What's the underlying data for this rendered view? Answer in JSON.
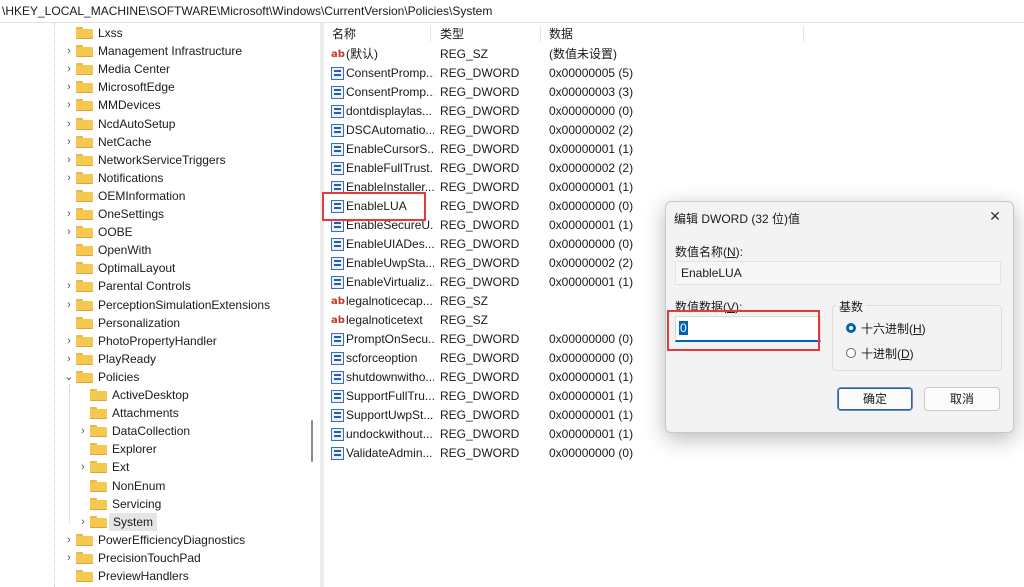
{
  "address_bar": "\\HKEY_LOCAL_MACHINE\\SOFTWARE\\Microsoft\\Windows\\CurrentVersion\\Policies\\System",
  "tree": {
    "items": [
      {
        "label": "Lxss",
        "level": 0,
        "chevron": ""
      },
      {
        "label": "Management Infrastructure",
        "level": 0,
        "chevron": ">"
      },
      {
        "label": "Media Center",
        "level": 0,
        "chevron": ">"
      },
      {
        "label": "MicrosoftEdge",
        "level": 0,
        "chevron": ">"
      },
      {
        "label": "MMDevices",
        "level": 0,
        "chevron": ">"
      },
      {
        "label": "NcdAutoSetup",
        "level": 0,
        "chevron": ">"
      },
      {
        "label": "NetCache",
        "level": 0,
        "chevron": ">"
      },
      {
        "label": "NetworkServiceTriggers",
        "level": 0,
        "chevron": ">"
      },
      {
        "label": "Notifications",
        "level": 0,
        "chevron": ">"
      },
      {
        "label": "OEMInformation",
        "level": 0,
        "chevron": ""
      },
      {
        "label": "OneSettings",
        "level": 0,
        "chevron": ">"
      },
      {
        "label": "OOBE",
        "level": 0,
        "chevron": ">"
      },
      {
        "label": "OpenWith",
        "level": 0,
        "chevron": ""
      },
      {
        "label": "OptimalLayout",
        "level": 0,
        "chevron": ""
      },
      {
        "label": "Parental Controls",
        "level": 0,
        "chevron": ">"
      },
      {
        "label": "PerceptionSimulationExtensions",
        "level": 0,
        "chevron": ">"
      },
      {
        "label": "Personalization",
        "level": 0,
        "chevron": ""
      },
      {
        "label": "PhotoPropertyHandler",
        "level": 0,
        "chevron": ">"
      },
      {
        "label": "PlayReady",
        "level": 0,
        "chevron": ">"
      },
      {
        "label": "Policies",
        "level": 0,
        "chevron": "v"
      },
      {
        "label": "ActiveDesktop",
        "level": 1,
        "chevron": ""
      },
      {
        "label": "Attachments",
        "level": 1,
        "chevron": ""
      },
      {
        "label": "DataCollection",
        "level": 1,
        "chevron": ">"
      },
      {
        "label": "Explorer",
        "level": 1,
        "chevron": ""
      },
      {
        "label": "Ext",
        "level": 1,
        "chevron": ">"
      },
      {
        "label": "NonEnum",
        "level": 1,
        "chevron": ""
      },
      {
        "label": "Servicing",
        "level": 1,
        "chevron": ""
      },
      {
        "label": "System",
        "level": 1,
        "chevron": ">",
        "selected": true
      },
      {
        "label": "PowerEfficiencyDiagnostics",
        "level": 0,
        "chevron": ">"
      },
      {
        "label": "PrecisionTouchPad",
        "level": 0,
        "chevron": ">"
      },
      {
        "label": "PreviewHandlers",
        "level": 0,
        "chevron": ""
      }
    ]
  },
  "list": {
    "headers": {
      "name": "名称",
      "type": "类型",
      "data": "数据"
    },
    "rows": [
      {
        "icon": "string",
        "name": "(默认)",
        "type": "REG_SZ",
        "data": "(数值未设置)"
      },
      {
        "icon": "dword",
        "name": "ConsentPromp...",
        "type": "REG_DWORD",
        "data": "0x00000005 (5)"
      },
      {
        "icon": "dword",
        "name": "ConsentPromp...",
        "type": "REG_DWORD",
        "data": "0x00000003 (3)"
      },
      {
        "icon": "dword",
        "name": "dontdisplaylas...",
        "type": "REG_DWORD",
        "data": "0x00000000 (0)"
      },
      {
        "icon": "dword",
        "name": "DSCAutomatio...",
        "type": "REG_DWORD",
        "data": "0x00000002 (2)"
      },
      {
        "icon": "dword",
        "name": "EnableCursorS...",
        "type": "REG_DWORD",
        "data": "0x00000001 (1)"
      },
      {
        "icon": "dword",
        "name": "EnableFullTrust...",
        "type": "REG_DWORD",
        "data": "0x00000002 (2)"
      },
      {
        "icon": "dword",
        "name": "EnableInstaller...",
        "type": "REG_DWORD",
        "data": "0x00000001 (1)"
      },
      {
        "icon": "dword",
        "name": "EnableLUA",
        "type": "REG_DWORD",
        "data": "0x00000000 (0)"
      },
      {
        "icon": "dword",
        "name": "EnableSecureU...",
        "type": "REG_DWORD",
        "data": "0x00000001 (1)"
      },
      {
        "icon": "dword",
        "name": "EnableUIADes...",
        "type": "REG_DWORD",
        "data": "0x00000000 (0)"
      },
      {
        "icon": "dword",
        "name": "EnableUwpSta...",
        "type": "REG_DWORD",
        "data": "0x00000002 (2)"
      },
      {
        "icon": "dword",
        "name": "EnableVirtualiz...",
        "type": "REG_DWORD",
        "data": "0x00000001 (1)"
      },
      {
        "icon": "string",
        "name": "legalnoticecap...",
        "type": "REG_SZ",
        "data": ""
      },
      {
        "icon": "string",
        "name": "legalnoticetext",
        "type": "REG_SZ",
        "data": ""
      },
      {
        "icon": "dword",
        "name": "PromptOnSecu...",
        "type": "REG_DWORD",
        "data": "0x00000000 (0)"
      },
      {
        "icon": "dword",
        "name": "scforceoption",
        "type": "REG_DWORD",
        "data": "0x00000000 (0)"
      },
      {
        "icon": "dword",
        "name": "shutdownwitho...",
        "type": "REG_DWORD",
        "data": "0x00000001 (1)"
      },
      {
        "icon": "dword",
        "name": "SupportFullTru...",
        "type": "REG_DWORD",
        "data": "0x00000001 (1)"
      },
      {
        "icon": "dword",
        "name": "SupportUwpSt...",
        "type": "REG_DWORD",
        "data": "0x00000001 (1)"
      },
      {
        "icon": "dword",
        "name": "undockwithout...",
        "type": "REG_DWORD",
        "data": "0x00000001 (1)"
      },
      {
        "icon": "dword",
        "name": "ValidateAdmin...",
        "type": "REG_DWORD",
        "data": "0x00000000 (0)"
      }
    ]
  },
  "dialog": {
    "title": "编辑 DWORD (32 位)值",
    "close_glyph": "✕",
    "value_name_label": "数值名称(",
    "value_name_key": "N",
    "value_name_label_end": "):",
    "value_name": "EnableLUA",
    "value_data_label": "数值数据(",
    "value_data_key": "V",
    "value_data_label_end": "):",
    "value_data": "0",
    "base_title": "基数",
    "radio_hex": "十六进制(",
    "radio_hex_key": "H",
    "radio_dec": "十进制(",
    "radio_dec_key": "D",
    "radio_end": ")",
    "ok": "确定",
    "cancel": "取消"
  },
  "colors": {
    "highlight_box": "#e23b3b",
    "accent": "#0063b1"
  }
}
